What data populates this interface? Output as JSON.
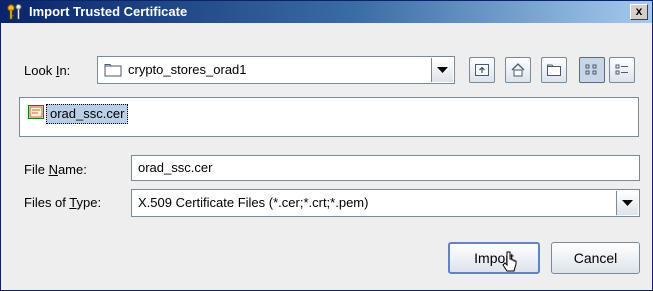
{
  "window": {
    "title": "Import Trusted Certificate",
    "close_label": "x"
  },
  "lookin": {
    "label_pre": "Look ",
    "label_mnemonic": "I",
    "label_post": "n:",
    "value": "crypto_stores_orad1"
  },
  "toolbar": {
    "icons": [
      "up-one-level-icon",
      "home-icon",
      "new-folder-icon",
      "list-view-icon",
      "details-view-icon"
    ]
  },
  "file_list": {
    "items": [
      {
        "name": "orad_ssc.cer",
        "icon": "certificate-icon",
        "selected": true
      }
    ]
  },
  "file_name": {
    "label_pre": "File ",
    "label_mnemonic": "N",
    "label_post": "ame:",
    "value": "orad_ssc.cer"
  },
  "file_type": {
    "label_pre": "Files of ",
    "label_mnemonic": "T",
    "label_post": "ype:",
    "value": "X.509 Certificate Files (*.cer;*.crt;*.pem)"
  },
  "buttons": {
    "import_label": "Import",
    "cancel_label": "Cancel"
  },
  "colors": {
    "title_gradient_start": "#0a246a",
    "selection": "#b8cfe5",
    "dialog_bg": "#eeeeee"
  }
}
